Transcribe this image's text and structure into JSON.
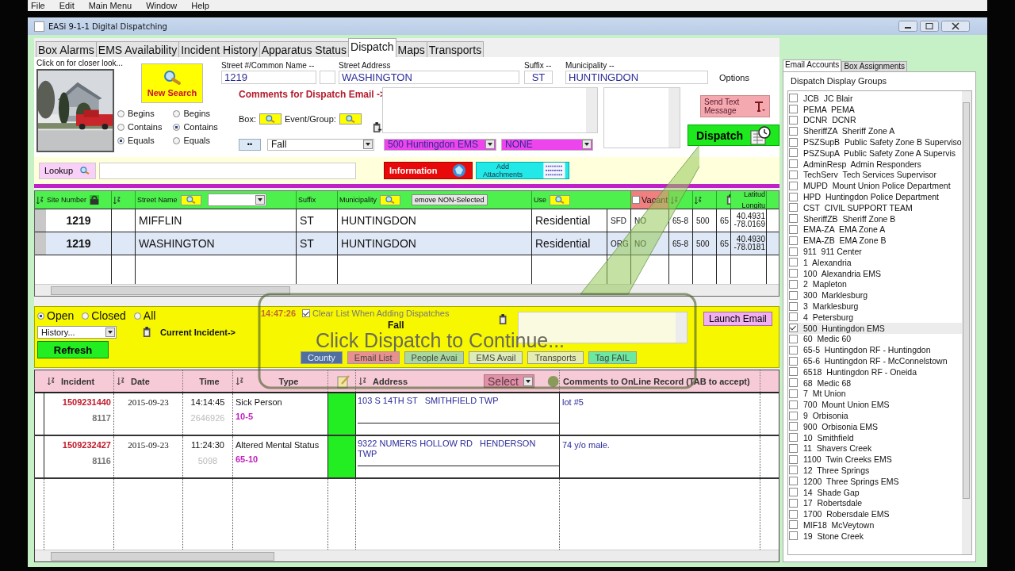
{
  "menu": [
    "File",
    "Edit",
    "Main Menu",
    "Window",
    "Help"
  ],
  "window": {
    "title": "EASi 9-1-1 Digital Dispatching"
  },
  "tabs": [
    {
      "label": "Box Alarms",
      "selected": false
    },
    {
      "label": "EMS Availability",
      "selected": false
    },
    {
      "label": "Incident History",
      "selected": false
    },
    {
      "label": "Apparatus Status",
      "selected": false
    },
    {
      "label": "Dispatch",
      "selected": true
    },
    {
      "label": "Maps",
      "selected": false
    },
    {
      "label": "Transports",
      "selected": false
    }
  ],
  "search": {
    "photo_caption": "Click on for closer look...",
    "new_search": "New Search",
    "street_number": {
      "label": "Street #/Common Name --",
      "value": "1219"
    },
    "street_address": {
      "label": "Street Address",
      "value": "WASHINGTON"
    },
    "suffix": {
      "label": "Suffix --",
      "value": "ST"
    },
    "municipality": {
      "label": "Municipality --",
      "value": "HUNTINGDON"
    },
    "options_label": "Options",
    "match_number": [
      {
        "label": "Begins",
        "selected": false
      },
      {
        "label": "Contains",
        "selected": false
      },
      {
        "label": "Equals",
        "selected": true
      }
    ],
    "match_street": [
      {
        "label": "Begins",
        "selected": false
      },
      {
        "label": "Contains",
        "selected": true
      },
      {
        "label": "Equals",
        "selected": false
      }
    ]
  },
  "dispatch": {
    "comments_label": "Comments for Dispatch Email ->",
    "box_label": "Box:",
    "event_label": "Event/Group:",
    "more_button": "••",
    "nature": "Fall",
    "unit": "500 Huntingdon EMS",
    "other": "NONE",
    "send_text": "Send Text Message",
    "dispatch_button": "Dispatch"
  },
  "lookup": {
    "button": "Lookup",
    "information": "Information",
    "attachments": "Add Attachments"
  },
  "results": {
    "headers": {
      "site": "Site Number",
      "street": "Street Name",
      "suffix": "Suffix",
      "municipality": "Municipality",
      "remove": "emove NON-Selected",
      "use": "Use",
      "vacant": {
        "label": "Vacant",
        "checked": false
      },
      "lat": "Latitud",
      "lon": "Longitu"
    },
    "rows": [
      {
        "selected": false,
        "site": "1219",
        "street": "MIFFLIN",
        "suffix": "ST",
        "municipality": "HUNTINGDON",
        "use": "Residential",
        "type": "SFD",
        "vacant": "NO",
        "box": "65-8",
        "station": "500",
        "code": "65",
        "lat": "40.4931",
        "lon": "-78.0169"
      },
      {
        "selected": true,
        "site": "1219",
        "street": "WASHINGTON",
        "suffix": "ST",
        "municipality": "HUNTINGDON",
        "use": "Residential",
        "type": "ORG",
        "vacant": "NO",
        "box": "65-8",
        "station": "500",
        "code": "65",
        "lat": "40.4930",
        "lon": "-78.0181"
      }
    ]
  },
  "incident_panel": {
    "filters": [
      {
        "label": "Open",
        "selected": true
      },
      {
        "label": "Closed",
        "selected": false
      },
      {
        "label": "All",
        "selected": false
      }
    ],
    "history": "History...",
    "current": "Current Incident->",
    "refresh": "Refresh",
    "time": "14:47:26",
    "clear_list": {
      "label": "Clear List When Adding Dispatches",
      "checked": true
    },
    "nature": "Fall",
    "launch_email": "Launch Email",
    "buttons": [
      {
        "label": "County",
        "color": "#4f6fa0"
      },
      {
        "label": "Email List",
        "color": "#e89090"
      },
      {
        "label": "People Avai",
        "color": "#a8d8a0"
      },
      {
        "label": "EMS Avail",
        "color": "#dcebb8"
      },
      {
        "label": "Transports",
        "color": "#e4ecb0"
      },
      {
        "label": "Tag FAIL",
        "color": "#6ce8a0"
      }
    ]
  },
  "callout": {
    "text": "Click Dispatch to Continue..."
  },
  "incidents": {
    "headers": {
      "incident": "Incident",
      "date": "Date",
      "time": "Time",
      "type": "Type",
      "address": "Address",
      "select": "Select",
      "comments": "Comments to OnLine Record (TAB to accept)"
    },
    "rows": [
      {
        "incident": "1509231440",
        "unit": "8117",
        "date": "2015-09-23",
        "time": "14:14:45",
        "ref": "2646926",
        "type": "Sick Person",
        "code": "10-5",
        "address": "103 S 14TH ST   SMITHFIELD TWP",
        "comment": "lot #5"
      },
      {
        "incident": "1509232427",
        "unit": "8116",
        "date": "2015-09-23",
        "time": "11:24:30",
        "ref": "5098",
        "type": "Altered Mental Status",
        "code": "65-10",
        "address": "9322 NUMERS HOLLOW RD   HENDERSON TWP",
        "comment": "74 y/o male."
      }
    ]
  },
  "side": {
    "tabs": [
      {
        "label": "Email Accounts",
        "selected": true
      },
      {
        "label": "Box Assignments",
        "selected": false
      }
    ],
    "heading": "Dispatch Display Groups",
    "groups": [
      {
        "label": "JCB  JC Blair",
        "checked": false
      },
      {
        "label": "PEMA  PEMA",
        "checked": false
      },
      {
        "label": "DCNR  DCNR",
        "checked": false
      },
      {
        "label": "SheriffZA  Sheriff Zone A",
        "checked": false
      },
      {
        "label": "PSZSupB  Public Safety Zone B Superviso",
        "checked": false
      },
      {
        "label": "PSZSupA  Public Safety Zone A Supervis",
        "checked": false
      },
      {
        "label": "AdminResp  Admin Responders",
        "checked": false
      },
      {
        "label": "TechServ  Tech Services Supervisor",
        "checked": false
      },
      {
        "label": "MUPD  Mount Union Police Department",
        "checked": false
      },
      {
        "label": "HPD  Huntingdon Police Department",
        "checked": false
      },
      {
        "label": "CST  CIVIL SUPPORT TEAM",
        "checked": false
      },
      {
        "label": "SheriffZB  Sheriff Zone B",
        "checked": false
      },
      {
        "label": "EMA-ZA  EMA Zone A",
        "checked": false
      },
      {
        "label": "EMA-ZB  EMA Zone B",
        "checked": false
      },
      {
        "label": "911  911 Center",
        "checked": false
      },
      {
        "label": "1  Alexandria",
        "checked": false
      },
      {
        "label": "100  Alexandria EMS",
        "checked": false
      },
      {
        "label": "2  Mapleton",
        "checked": false
      },
      {
        "label": "300  Marklesburg",
        "checked": false
      },
      {
        "label": "3  Marklesburg",
        "checked": false
      },
      {
        "label": "4  Petersburg",
        "checked": false
      },
      {
        "label": "500  Huntingdon EMS",
        "checked": true
      },
      {
        "label": "60  Medic 60",
        "checked": false
      },
      {
        "label": "65-5  Huntingdon RF - Huntingdon",
        "checked": false
      },
      {
        "label": "65-6  Huntingdon RF - McConnelstown",
        "checked": false
      },
      {
        "label": "6518  Huntingdon RF - Oneida",
        "checked": false
      },
      {
        "label": "68  Medic 68",
        "checked": false
      },
      {
        "label": "7  Mt Union",
        "checked": false
      },
      {
        "label": "700  Mount Union EMS",
        "checked": false
      },
      {
        "label": "9  Orbisonia",
        "checked": false
      },
      {
        "label": "900  Orbisonia EMS",
        "checked": false
      },
      {
        "label": "10  Smithfield",
        "checked": false
      },
      {
        "label": "11  Shavers Creek",
        "checked": false
      },
      {
        "label": "1100  Twin Creeks EMS",
        "checked": false
      },
      {
        "label": "12  Three Springs",
        "checked": false
      },
      {
        "label": "1200  Three Springs EMS",
        "checked": false
      },
      {
        "label": "14  Shade Gap",
        "checked": false
      },
      {
        "label": "17  Robertsdale",
        "checked": false
      },
      {
        "label": "1700  Robersdale EMS",
        "checked": false
      },
      {
        "label": "MIF18  McVeytown",
        "checked": false
      },
      {
        "label": "19  Stone Creek",
        "checked": false
      }
    ]
  }
}
